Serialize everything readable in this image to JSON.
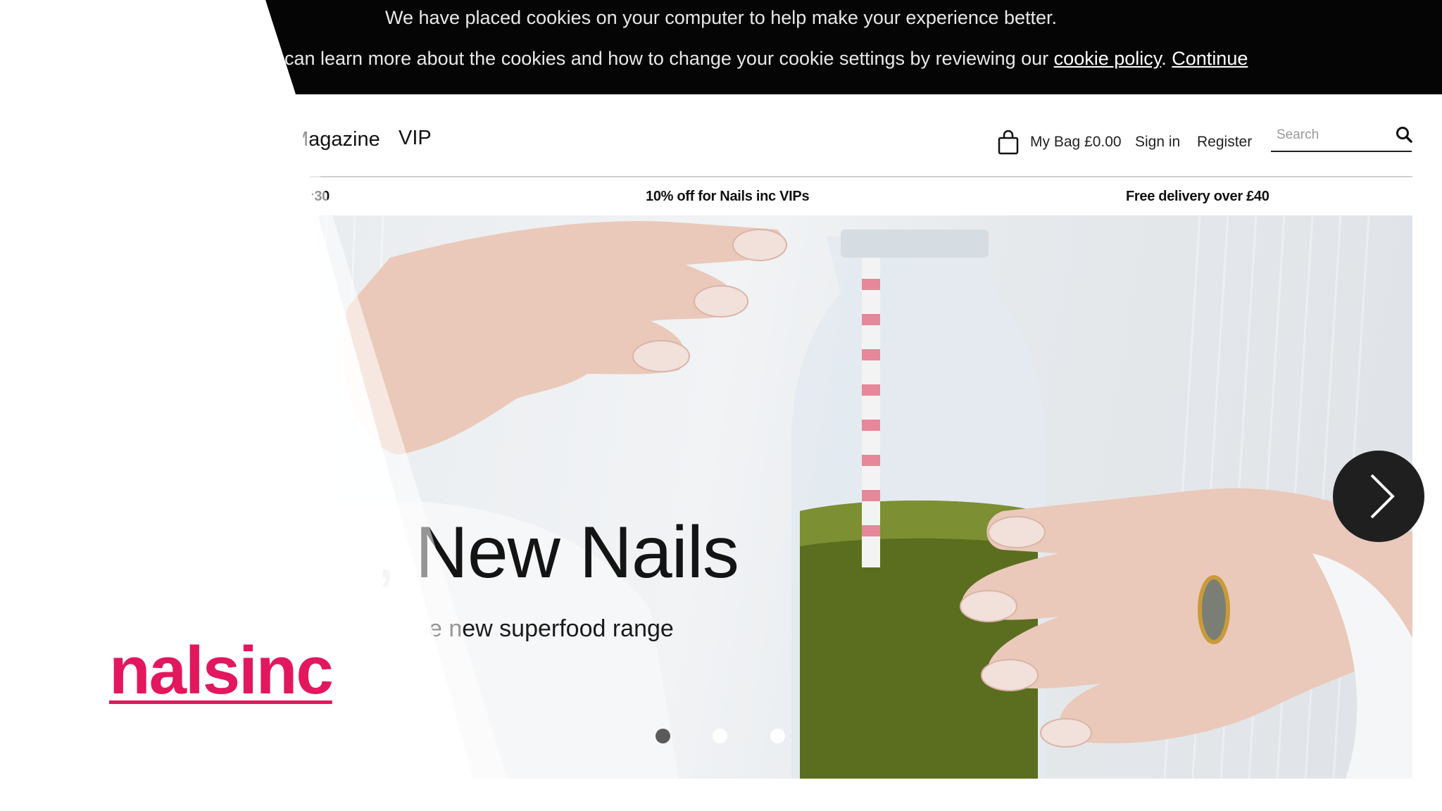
{
  "cookie_banner": {
    "line1": "We have placed cookies on your computer to help make your experience better.",
    "line2_prefix": "can learn more about the cookies and how to change your cookie settings by reviewing our",
    "policy_link": "cookie policy",
    "separator": ".",
    "continue_link": "Continue"
  },
  "nav": {
    "magazine": "Magazine",
    "vip": "VIP"
  },
  "header": {
    "bag_label": "My Bag £0.00",
    "sign_in": "Sign in",
    "register": "Register",
    "search_placeholder": "Search"
  },
  "promo_bar": {
    "left": ":30",
    "center": "10% off for Nails inc VIPs",
    "right": "Free delivery over £40"
  },
  "hero": {
    "title": ", New Nails",
    "subtitle": "e new superfood range",
    "slide_count": 3,
    "active_slide": 1
  },
  "overlay": {
    "logo_text": "nalsinc",
    "logo_color": "#e3175d"
  }
}
